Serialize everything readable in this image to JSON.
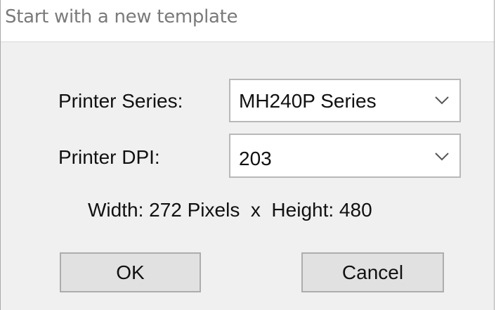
{
  "window": {
    "title": "Start with a new template"
  },
  "form": {
    "series_label": "Printer Series:",
    "series_value": "MH240P Series",
    "dpi_label": "Printer DPI:",
    "dpi_value": "203",
    "dimensions_text": "Width: 272 Pixels  x  Height: 480"
  },
  "buttons": {
    "ok_label": "OK",
    "cancel_label": "Cancel"
  },
  "icons": {
    "dropdown": "chevron-down-icon"
  },
  "colors": {
    "dialog_background": "#f0f0f0",
    "title_background": "#ffffff",
    "title_text": "#7a7a7a",
    "button_background": "#e1e1e1",
    "border": "#adadad"
  }
}
